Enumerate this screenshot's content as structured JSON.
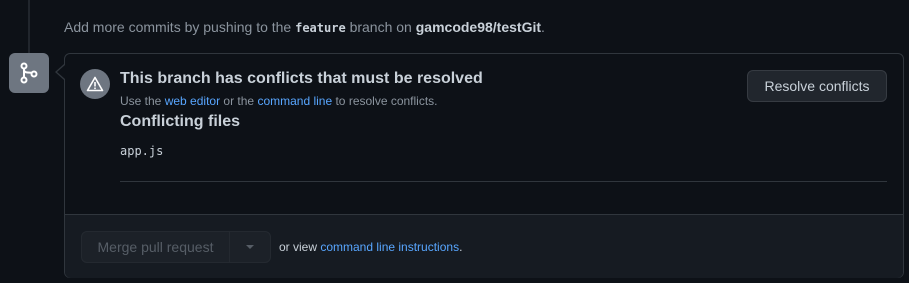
{
  "hint": {
    "prefix": "Add more commits by pushing to the ",
    "branch": "feature",
    "middle": " branch on ",
    "repo": "gamcode98/testGit",
    "suffix": "."
  },
  "conflict": {
    "title": "This branch has conflicts that must be resolved",
    "subtitle_prefix": "Use the ",
    "web_editor_link": "web editor",
    "subtitle_middle": " or the ",
    "command_line_link": "command line",
    "subtitle_suffix": " to resolve conflicts.",
    "resolve_button": "Resolve conflicts"
  },
  "files": {
    "heading": "Conflicting files",
    "items": [
      "app.js"
    ]
  },
  "footer": {
    "merge_button": "Merge pull request",
    "or_view": "or view ",
    "instructions_link": "command line instructions",
    "period": "."
  },
  "icons": {
    "timeline": "git-branch-icon",
    "warning": "alert-icon",
    "dropdown": "triangle-down-icon"
  },
  "colors": {
    "background": "#0d1117",
    "border": "#30363d",
    "link": "#58a6ff",
    "muted": "#8b949e",
    "text": "#c9d1d9",
    "icon_bg": "#6e7681"
  }
}
